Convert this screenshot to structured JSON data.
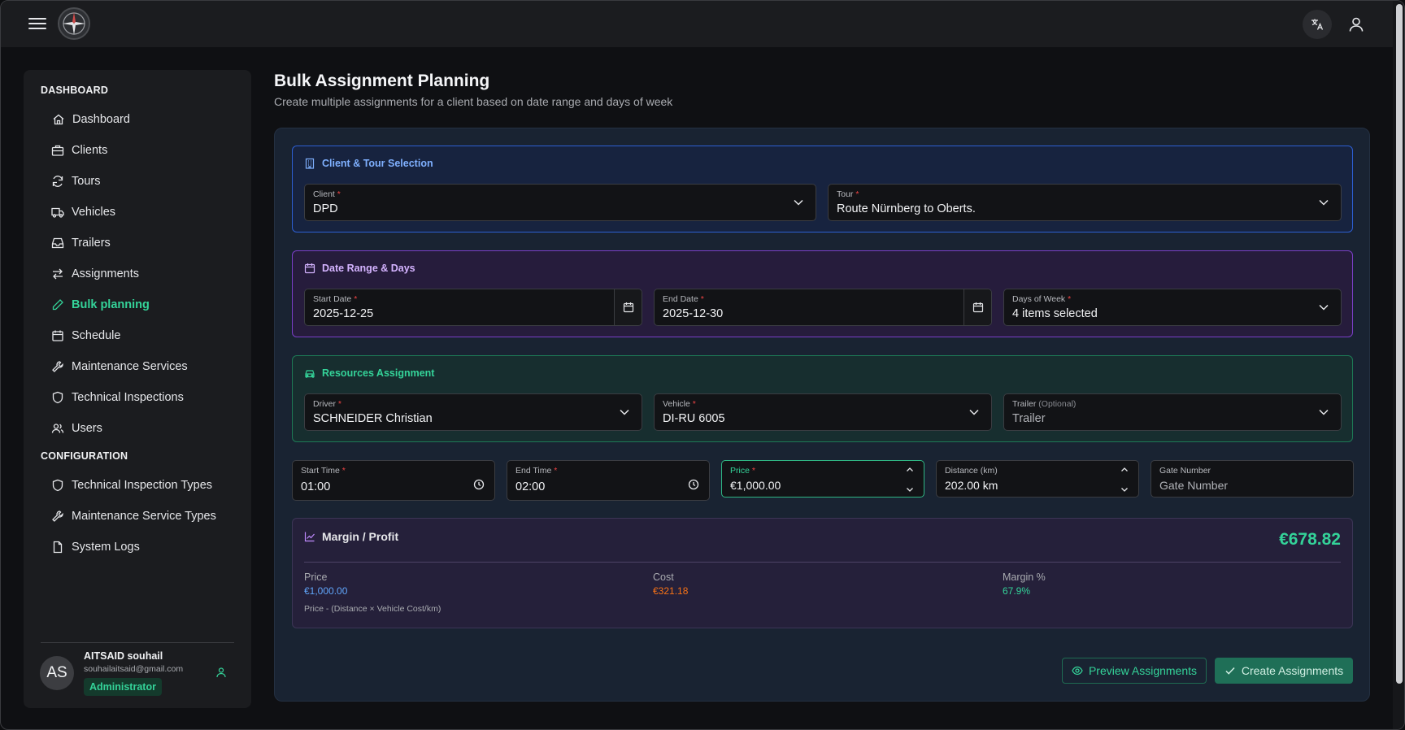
{
  "header": {
    "menu_icon": "hamburger-menu-icon",
    "logo_icon": "compass-logo-icon",
    "translate_icon": "translate-icon",
    "user_icon": "user-icon"
  },
  "sidebar": {
    "section_dashboard": "DASHBOARD",
    "items": [
      {
        "label": "Dashboard",
        "icon": "home-icon"
      },
      {
        "label": "Clients",
        "icon": "briefcase-icon"
      },
      {
        "label": "Tours",
        "icon": "refresh-icon"
      },
      {
        "label": "Vehicles",
        "icon": "truck-icon"
      },
      {
        "label": "Trailers",
        "icon": "inbox-icon"
      },
      {
        "label": "Assignments",
        "icon": "arrows-swap-icon"
      },
      {
        "label": "Bulk planning",
        "icon": "pencil-icon",
        "active": true
      },
      {
        "label": "Schedule",
        "icon": "calendar-icon"
      },
      {
        "label": "Maintenance Services",
        "icon": "wrench-icon"
      },
      {
        "label": "Technical Inspections",
        "icon": "shield-icon"
      },
      {
        "label": "Users",
        "icon": "users-icon"
      }
    ],
    "section_configuration": "CONFIGURATION",
    "config_items": [
      {
        "label": "Technical Inspection Types",
        "icon": "shield-icon"
      },
      {
        "label": "Maintenance Service Types",
        "icon": "wrench-icon"
      },
      {
        "label": "System Logs",
        "icon": "file-icon"
      }
    ],
    "user": {
      "initials": "AS",
      "name": "AITSAID souhail",
      "email": "souhailaitsaid@gmail.com",
      "role": "Administrator"
    }
  },
  "main": {
    "title": "Bulk Assignment Planning",
    "subtitle": "Create multiple assignments for a client based on date range and days of week",
    "client_tour": {
      "title": "Client & Tour Selection",
      "client_label": "Client",
      "client_value": "DPD",
      "tour_label": "Tour",
      "tour_value": "Route Nürnberg to Oberts."
    },
    "date_range": {
      "title": "Date Range & Days",
      "start_label": "Start Date",
      "start_value": "2025-12-25",
      "end_label": "End Date",
      "end_value": "2025-12-30",
      "days_label": "Days of Week",
      "days_value": "4 items selected"
    },
    "resources": {
      "title": "Resources Assignment",
      "driver_label": "Driver",
      "driver_value": "SCHNEIDER Christian",
      "vehicle_label": "Vehicle",
      "vehicle_value": "DI-RU 6005",
      "trailer_label": "Trailer",
      "trailer_optional": "(Optional)",
      "trailer_placeholder": "Trailer"
    },
    "timing": {
      "start_time_label": "Start Time",
      "start_time_value": "01:00",
      "end_time_label": "End Time",
      "end_time_value": "02:00",
      "price_label": "Price",
      "price_value": "€1,000.00",
      "distance_label": "Distance (km)",
      "distance_value": "202.00 km",
      "gate_label": "Gate Number",
      "gate_placeholder": "Gate Number"
    },
    "margin": {
      "title": "Margin / Profit",
      "amount": "€678.82",
      "price_label": "Price",
      "price_value": "€1,000.00",
      "cost_label": "Cost",
      "cost_value": "€321.18",
      "margin_label": "Margin %",
      "margin_value": "67.9%",
      "formula": "Price - (Distance × Vehicle Cost/km)"
    },
    "actions": {
      "preview_label": "Preview Assignments",
      "create_label": "Create Assignments"
    }
  },
  "colors": {
    "accent_green": "#34d399",
    "blue_panel": "#2563eb",
    "purple_panel": "#7e22ce",
    "green_panel": "#15803d",
    "price_blue": "#60a5fa",
    "cost_orange": "#f97316",
    "required_red": "#ef4444"
  }
}
